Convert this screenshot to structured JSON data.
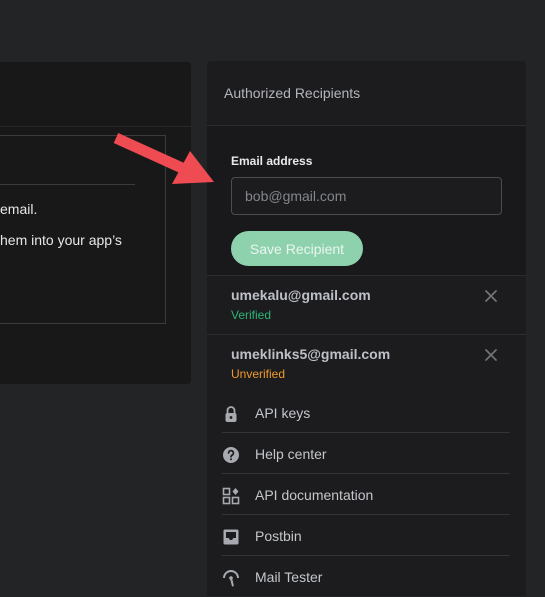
{
  "left_panel": {
    "line1": "email.",
    "line2": "hem into your app’s"
  },
  "recipients_panel": {
    "title": "Authorized Recipients",
    "form": {
      "email_label": "Email address",
      "email_placeholder": "bob@gmail.com",
      "email_value": "",
      "save_label": "Save Recipient"
    },
    "recipients": [
      {
        "email": "umekalu@gmail.com",
        "status": "Verified"
      },
      {
        "email": "umeklinks5@gmail.com",
        "status": "Unverified"
      }
    ]
  },
  "nav": [
    {
      "label": "API keys",
      "icon": "lock-icon"
    },
    {
      "label": "Help center",
      "icon": "help-icon"
    },
    {
      "label": "API documentation",
      "icon": "api-docs-icon"
    },
    {
      "label": "Postbin",
      "icon": "inbox-icon"
    },
    {
      "label": "Mail Tester",
      "icon": "mail-tester-icon"
    }
  ],
  "colors": {
    "background": "#232426",
    "panel": "#1c1c1e",
    "save_button": "#8ed1ad",
    "verified": "#2cb673",
    "unverified": "#f09a2a",
    "arrow": "#ee4b52"
  }
}
